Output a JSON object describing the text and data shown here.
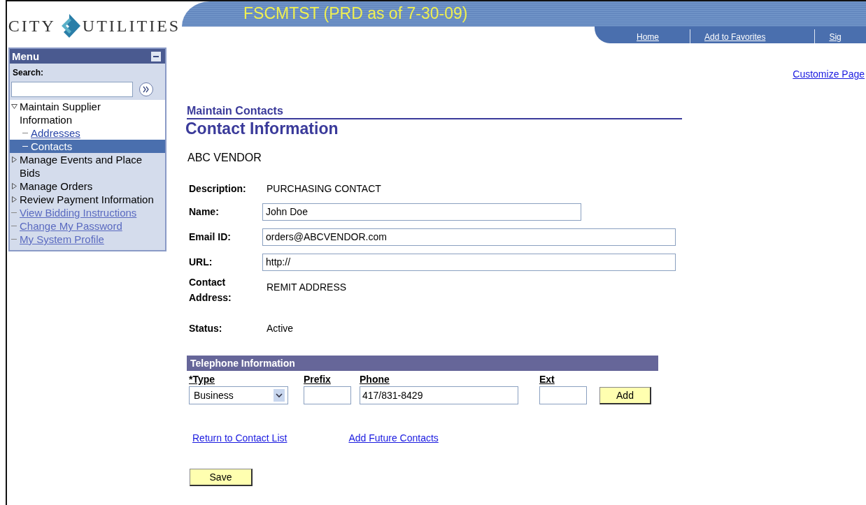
{
  "header": {
    "logo_left": "CITY",
    "logo_right": "UTILITIES",
    "banner_title": "FSCMTST (PRD as of 7-30-09)",
    "nav_links": [
      "Home",
      "Add to Favorites",
      "Sig"
    ]
  },
  "menu": {
    "title": "Menu",
    "search_label": "Search:",
    "items": [
      {
        "kind": "folder",
        "label": "Maintain Supplier Information",
        "expanded": true,
        "children": [
          {
            "kind": "link",
            "label": "Addresses",
            "selected": false
          },
          {
            "kind": "link",
            "label": "Contacts",
            "selected": true
          }
        ]
      },
      {
        "kind": "folder",
        "label": "Manage Events and Place Bids",
        "expanded": false
      },
      {
        "kind": "folder",
        "label": "Manage Orders",
        "expanded": false
      },
      {
        "kind": "folder",
        "label": "Review Payment Information",
        "expanded": false
      },
      {
        "kind": "link",
        "label": "View Bidding Instructions",
        "selected": false
      },
      {
        "kind": "link",
        "label": "Change My Password",
        "selected": false
      },
      {
        "kind": "link",
        "label": "My System Profile",
        "selected": false
      }
    ]
  },
  "customize_link": "Customize Page",
  "page": {
    "section": "Maintain Contacts",
    "title": "Contact Information",
    "vendor": "ABC VENDOR",
    "fields": [
      {
        "kind": "text",
        "label": "Description:",
        "value": "PURCHASING CONTACT"
      },
      {
        "kind": "input",
        "label": "Name:",
        "value": "John Doe"
      },
      {
        "kind": "input",
        "label": "Email ID:",
        "value": "orders@ABCVENDOR.com"
      },
      {
        "kind": "input",
        "label": "URL:",
        "value": "http://"
      },
      {
        "kind": "text",
        "label": "Contact Address:",
        "value": "REMIT ADDRESS"
      },
      {
        "kind": "text",
        "label": "Status:",
        "value": "Active"
      }
    ]
  },
  "telephone": {
    "title": "Telephone Information",
    "columns": [
      "*Type",
      "Prefix",
      "Phone",
      "Ext"
    ],
    "type": "Business",
    "phone": "417/831-8429",
    "add_button": "Add"
  },
  "links": [
    "Return to Contact List",
    "Add Future Contacts"
  ],
  "save_button": "Save"
}
